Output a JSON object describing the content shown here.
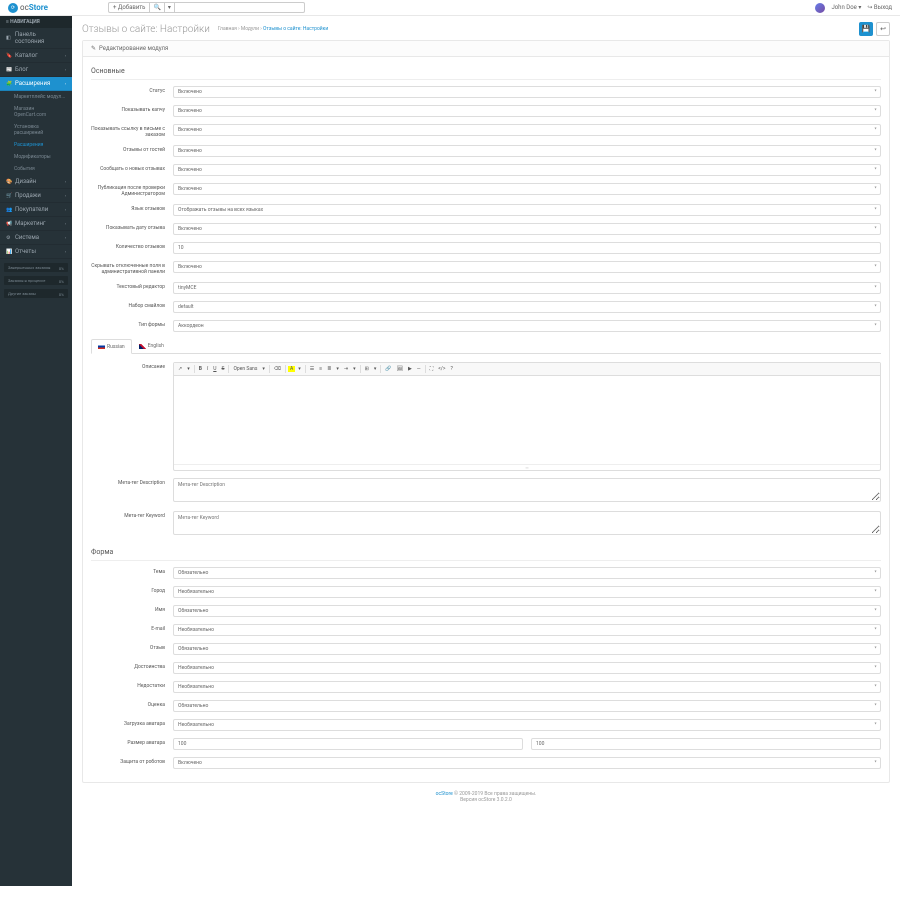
{
  "header": {
    "logo_text": "oc",
    "logo_text2": "Store",
    "btn_add": "+ Добавить",
    "user": "John Doe",
    "logout": "Выход"
  },
  "sidebar": {
    "nav_title": "НАВИГАЦИЯ",
    "items": [
      {
        "icon": "◧",
        "label": "Панель состояния"
      },
      {
        "icon": "🔖",
        "label": "Каталог"
      },
      {
        "icon": "📰",
        "label": "Блог"
      },
      {
        "icon": "🧩",
        "label": "Расширения"
      },
      {
        "icon": "🎨",
        "label": "Дизайн"
      },
      {
        "icon": "🛒",
        "label": "Продажи"
      },
      {
        "icon": "👥",
        "label": "Покупатели"
      },
      {
        "icon": "📢",
        "label": "Маркетинг"
      },
      {
        "icon": "⚙",
        "label": "Система"
      },
      {
        "icon": "📊",
        "label": "Отчеты"
      }
    ],
    "sub_items": [
      "Маркетплейс модул...",
      "Магазин OpenCart.com",
      "Установка расширений",
      "Расширения",
      "Модификаторы",
      "События"
    ],
    "stats": [
      "Завершенных заказов",
      "Заказов в процессе",
      "Другие заказы"
    ]
  },
  "page": {
    "title": "Отзывы о сайте:",
    "title_sub": "Настройки",
    "breadcrumb1": "Главная",
    "breadcrumb2": "Модули",
    "breadcrumb3": "Отзывы о сайте: Настройки",
    "panel_title": "Редактирование модуля"
  },
  "section1": "Основные",
  "fields": {
    "status": {
      "label": "Статус",
      "value": "Включено"
    },
    "show_captcha": {
      "label": "Показывать капчу",
      "value": "Включено"
    },
    "show_link": {
      "label": "Показывать ссылку в письме с заказом",
      "value": "Включено"
    },
    "guest_reviews": {
      "label": "Отзывы от гостей",
      "value": "Включено"
    },
    "notify_new": {
      "label": "Сообщать о новых отзывах",
      "value": "Включено"
    },
    "admin_publish": {
      "label": "Публикация после проверки Администратором",
      "value": "Включено"
    },
    "lang": {
      "label": "Язык отзывов",
      "value": "Отображать отзывы на всех языках"
    },
    "show_date": {
      "label": "Показывать дату отзыва",
      "value": "Включено"
    },
    "count": {
      "label": "Количество отзывов",
      "value": "10"
    },
    "hide_disabled": {
      "label": "Скрывать отключенные поля в административной панели",
      "value": "Включено"
    },
    "editor": {
      "label": "Текстовый редактор",
      "value": "tinyMCE"
    },
    "smilies": {
      "label": "Набор смайлов",
      "value": "default"
    },
    "form_type": {
      "label": "Тип формы",
      "value": "Аккордеон"
    }
  },
  "tabs": {
    "ru": "Russian",
    "en": "English"
  },
  "desc": {
    "label": "Описание",
    "meta_desc_label": "Мета-тег Description",
    "meta_desc_ph": "Мета-тег Description",
    "meta_kw_label": "Мета-тег Keyword",
    "meta_kw_ph": "Мета-тег Keyword"
  },
  "editor_toolbar": {
    "font": "Open Sans"
  },
  "section2": "Форма",
  "form_fields": {
    "subject": {
      "label": "Тема",
      "value": "Обязательно"
    },
    "city": {
      "label": "Город",
      "value": "Необязательно"
    },
    "name": {
      "label": "Имя",
      "value": "Обязательно"
    },
    "email": {
      "label": "E-mail",
      "value": "Необязательно"
    },
    "review": {
      "label": "Отзыв",
      "value": "Обязательно"
    },
    "pros": {
      "label": "Достоинства",
      "value": "Необязательно"
    },
    "cons": {
      "label": "Недостатки",
      "value": "Необязательно"
    },
    "rating": {
      "label": "Оценка",
      "value": "Обязательно"
    },
    "avatar": {
      "label": "Загрузка аватара",
      "value": "Необязательно"
    },
    "avatar_size": {
      "label": "Размер аватара",
      "v1": "100",
      "v2": "100"
    },
    "bot_protect": {
      "label": "Защита от роботов",
      "value": "Включено"
    }
  },
  "footer": {
    "link": "ocStore",
    "text1": " © 2009-2019 Все права защищены.",
    "text2": "Версия ocStore 3.0.2.0"
  }
}
